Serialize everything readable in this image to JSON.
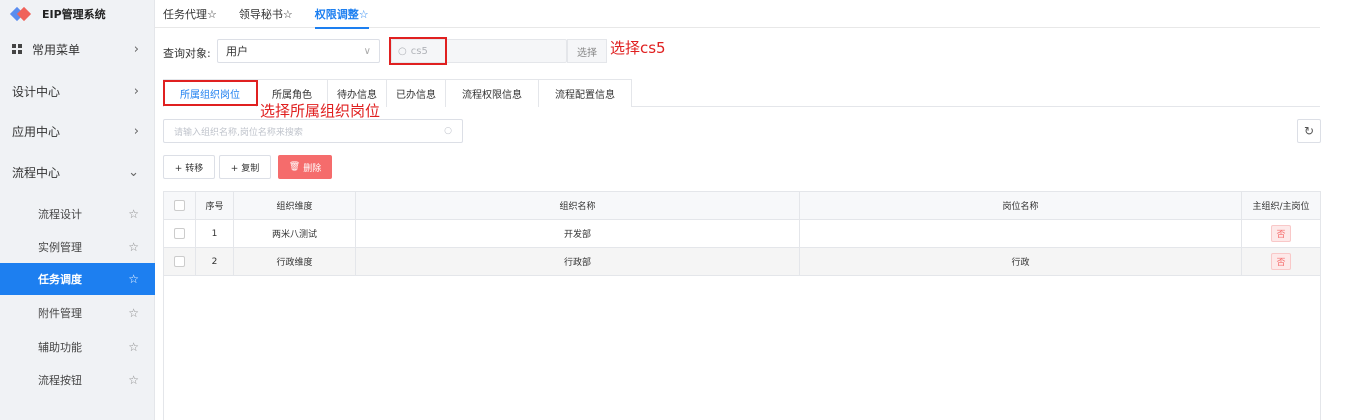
{
  "app": {
    "title": "EIP管理系统"
  },
  "sidebar": {
    "menus": [
      {
        "label": "常用菜单",
        "icon": "grid-icon",
        "chevron": "›"
      },
      {
        "label": "设计中心",
        "chevron": "›"
      },
      {
        "label": "应用中心",
        "chevron": "›"
      },
      {
        "label": "流程中心",
        "chevron": "⌄"
      }
    ],
    "subitems": [
      {
        "label": "流程设计",
        "active": false
      },
      {
        "label": "实例管理",
        "active": false
      },
      {
        "label": "任务调度",
        "active": true
      },
      {
        "label": "附件管理",
        "active": false
      },
      {
        "label": "辅助功能",
        "active": false
      },
      {
        "label": "流程按钮",
        "active": false
      }
    ],
    "star": "☆"
  },
  "top_tabs": [
    {
      "label": "任务代理☆",
      "active": false
    },
    {
      "label": "领导秘书☆",
      "active": false
    },
    {
      "label": "权限调整☆",
      "active": true
    }
  ],
  "query": {
    "label": "查询对象:",
    "select_value": "用户",
    "search_value": "cs5",
    "choose_label": "选择"
  },
  "annotations": {
    "cs5": "选择cs5",
    "org": "选择所属组织岗位"
  },
  "sub_tabs": [
    {
      "label": "所属组织岗位",
      "active": true
    },
    {
      "label": "所属角色"
    },
    {
      "label": "待办信息"
    },
    {
      "label": "已办信息"
    },
    {
      "label": "流程权限信息"
    },
    {
      "label": "流程配置信息"
    }
  ],
  "filter": {
    "placeholder": "请输入组织名称,岗位名称来搜索"
  },
  "actions": {
    "transfer": "+ 转移",
    "copy": "+ 复制",
    "delete": "删除"
  },
  "table": {
    "headers": [
      "序号",
      "组织维度",
      "组织名称",
      "岗位名称",
      "主组织/主岗位"
    ],
    "rows": [
      [
        "1",
        "两米八测试",
        "开发部",
        "",
        "否"
      ],
      [
        "2",
        "行政维度",
        "行政部",
        "行政",
        "否"
      ]
    ]
  },
  "colors": {
    "accent": "#1d7ff0",
    "danger": "#f56c6c",
    "annotation": "#e02020"
  }
}
